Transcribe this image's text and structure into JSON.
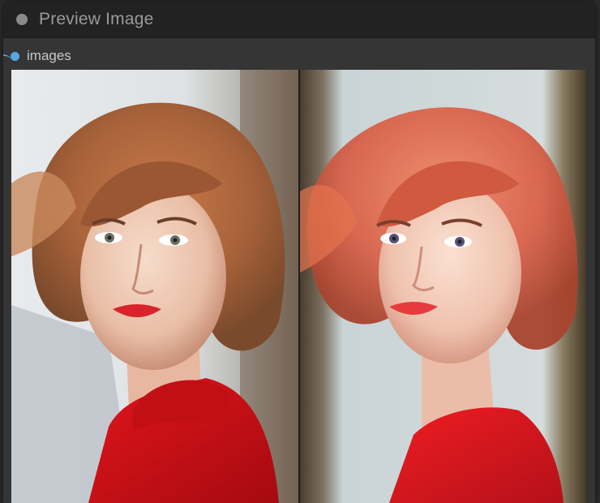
{
  "node": {
    "title": "Preview Image",
    "input_slot": {
      "label": "images",
      "color": "#5aa6e0"
    }
  },
  "preview_images": [
    {
      "alt": ""
    },
    {
      "alt": ""
    }
  ]
}
